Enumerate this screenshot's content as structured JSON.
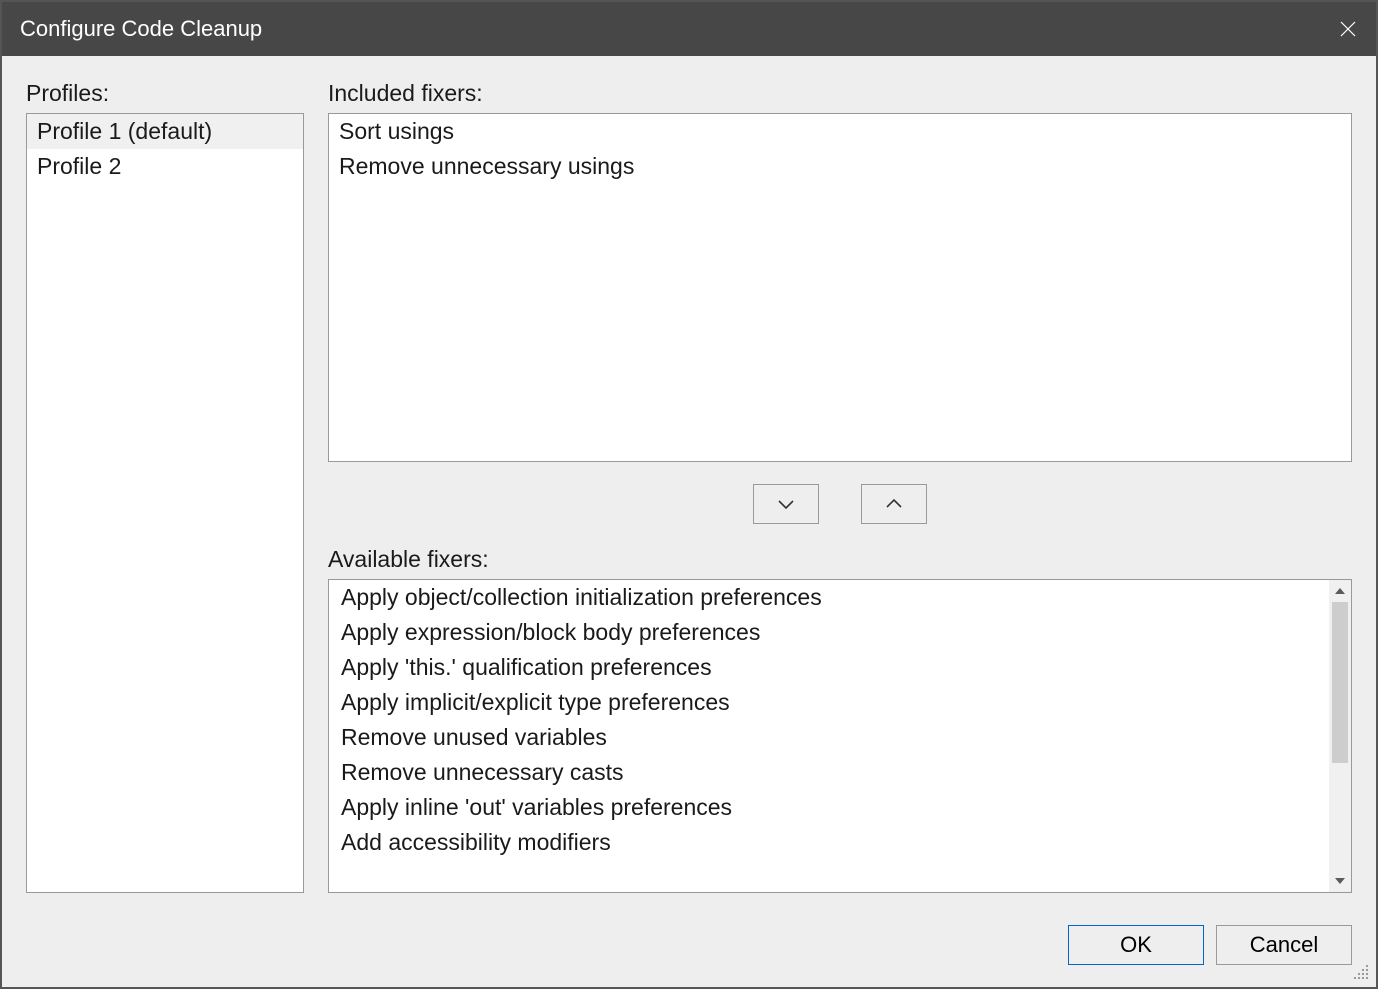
{
  "window": {
    "title": "Configure Code Cleanup"
  },
  "labels": {
    "profiles": "Profiles:",
    "included": "Included fixers:",
    "available": "Available fixers:"
  },
  "profiles": [
    {
      "label": "Profile 1 (default)",
      "selected": true
    },
    {
      "label": "Profile 2",
      "selected": false
    }
  ],
  "included_fixers": [
    "Sort usings",
    "Remove unnecessary usings"
  ],
  "available_fixers": [
    "Apply object/collection initialization preferences",
    "Apply expression/block body preferences",
    "Apply 'this.' qualification preferences",
    "Apply implicit/explicit type preferences",
    "Remove unused variables",
    "Remove unnecessary casts",
    "Apply inline 'out' variables preferences",
    "Add accessibility modifiers"
  ],
  "buttons": {
    "ok": "OK",
    "cancel": "Cancel"
  }
}
